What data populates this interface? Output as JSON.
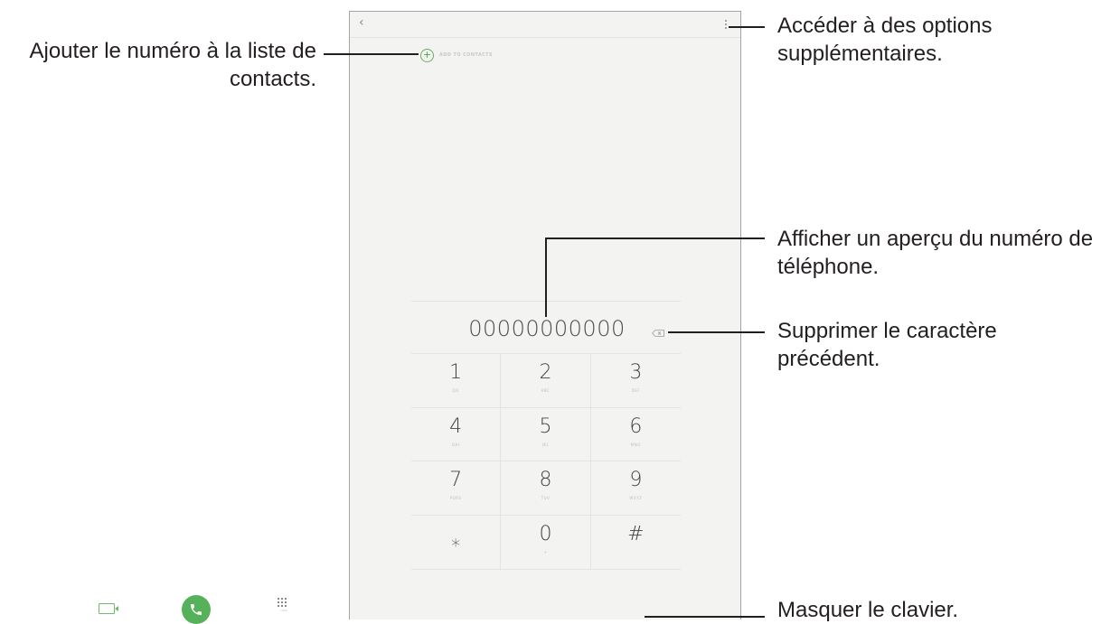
{
  "phone": {
    "back_icon": "‹",
    "add_contact_label": "ADD TO CONTACTS",
    "phone_number": "00000000000",
    "keys": [
      {
        "digit": "1",
        "letters": "QO"
      },
      {
        "digit": "2",
        "letters": "ABC"
      },
      {
        "digit": "3",
        "letters": "DEF"
      },
      {
        "digit": "4",
        "letters": "GHI"
      },
      {
        "digit": "5",
        "letters": "JKL"
      },
      {
        "digit": "6",
        "letters": "MNO"
      },
      {
        "digit": "7",
        "letters": "PQRS"
      },
      {
        "digit": "8",
        "letters": "TUV"
      },
      {
        "digit": "9",
        "letters": "WXYZ"
      },
      {
        "digit": "⁎",
        "letters": ""
      },
      {
        "digit": "0",
        "letters": "+"
      },
      {
        "digit": "#",
        "letters": ""
      }
    ],
    "hide_keypad_label": "HIDE",
    "icons": {
      "back": "chevron-left-icon",
      "more": "more-options-icon",
      "add": "plus-circle-icon",
      "backspace": "backspace-icon",
      "video": "video-call-icon",
      "call": "phone-call-icon",
      "keypad": "keypad-icon"
    },
    "colors": {
      "accent": "#56b25a",
      "screen_bg": "#f3f4f1",
      "text": "#444444"
    }
  },
  "callouts": {
    "add_contact": "Ajouter le numéro à la liste de contacts.",
    "more_options": "Accéder à des options supplémentaires.",
    "preview_number": "Afficher un aperçu du numéro de téléphone.",
    "delete_char": "Supprimer le caractère précédent.",
    "hide_keypad": "Masquer le clavier."
  }
}
